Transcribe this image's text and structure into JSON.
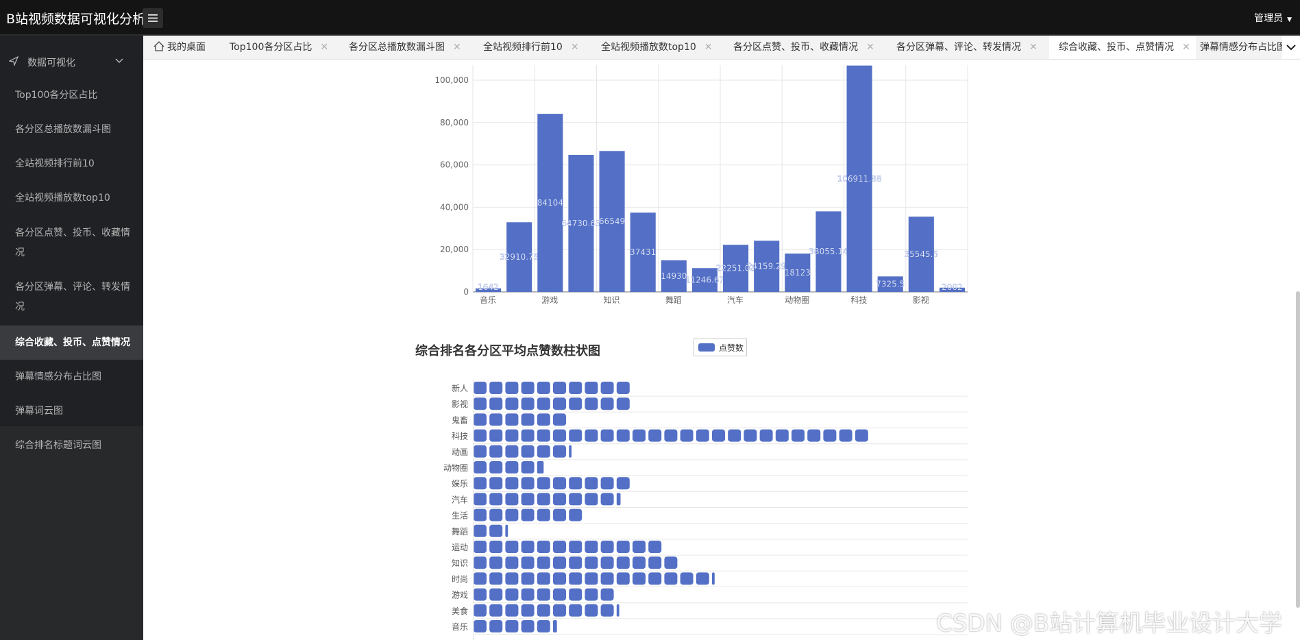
{
  "header": {
    "title": "B站视频数据可视化分析",
    "user": "管理员"
  },
  "sidebar": {
    "group_label": "数据可视化",
    "items": [
      {
        "label": "Top100各分区占比"
      },
      {
        "label": "各分区总播放数漏斗图"
      },
      {
        "label": "全站视频排行前10"
      },
      {
        "label": "全站视频播放数top10"
      },
      {
        "label": "各分区点赞、投币、收藏情况"
      },
      {
        "label": "各分区弹幕、评论、转发情况"
      },
      {
        "label": "综合收藏、投币、点赞情况"
      },
      {
        "label": "弹幕情感分布占比图"
      },
      {
        "label": "弹幕词云图"
      },
      {
        "label": "综合排名标题词云图"
      }
    ]
  },
  "tabs": [
    {
      "label": "我的桌面"
    },
    {
      "label": "Top100各分区占比"
    },
    {
      "label": "各分区总播放数漏斗图"
    },
    {
      "label": "全站视频排行前10"
    },
    {
      "label": "全站视频播放数top10"
    },
    {
      "label": "各分区点赞、投币、收藏情况"
    },
    {
      "label": "各分区弹幕、评论、转发情况"
    },
    {
      "label": "综合收藏、投币、点赞情况"
    },
    {
      "label": "弹幕情感分布占比图"
    }
  ],
  "watermark": "CSDN @B站计算机毕业设计大学",
  "chart_data": [
    {
      "type": "bar",
      "ylim": [
        0,
        100000
      ],
      "yticks": [
        "0",
        "20,000",
        "40,000",
        "60,000",
        "80,000",
        "100,000"
      ],
      "category_labels": [
        "音乐",
        "游戏",
        "知识",
        "舞蹈",
        "汽车",
        "动物圈",
        "科技",
        "影视"
      ],
      "values": [
        1642,
        32910.75,
        84104,
        64730.63,
        66549,
        37431,
        14930,
        11246.67,
        22251.02,
        24159.29,
        18123,
        38055.14,
        106911.88,
        7325.5,
        35545.5,
        2002
      ],
      "data_labels": [
        "1642",
        "32910.75",
        "84104",
        "64730.63",
        "66549",
        "37431",
        "14930",
        "11246.67",
        "22251.02",
        "24159.29",
        "18123",
        "38055.14",
        "106911.88",
        "7325.5",
        "35545.5",
        "2002"
      ],
      "color": "#5470c6"
    },
    {
      "type": "bar",
      "orientation": "horizontal",
      "title": "综合排名各分区平均点赞数柱状图",
      "legend": [
        "点赞数"
      ],
      "categories": [
        "新人",
        "影视",
        "鬼畜",
        "科技",
        "动画",
        "动物圈",
        "娱乐",
        "汽车",
        "生活",
        "舞蹈",
        "运动",
        "知识",
        "时尚",
        "游戏",
        "美食",
        "音乐"
      ],
      "values": [
        10,
        10,
        6,
        25,
        6.2,
        4.5,
        10,
        9.3,
        7,
        2.2,
        12,
        13,
        15.2,
        9,
        9.2,
        5.3
      ],
      "color": "#5470c6"
    }
  ]
}
